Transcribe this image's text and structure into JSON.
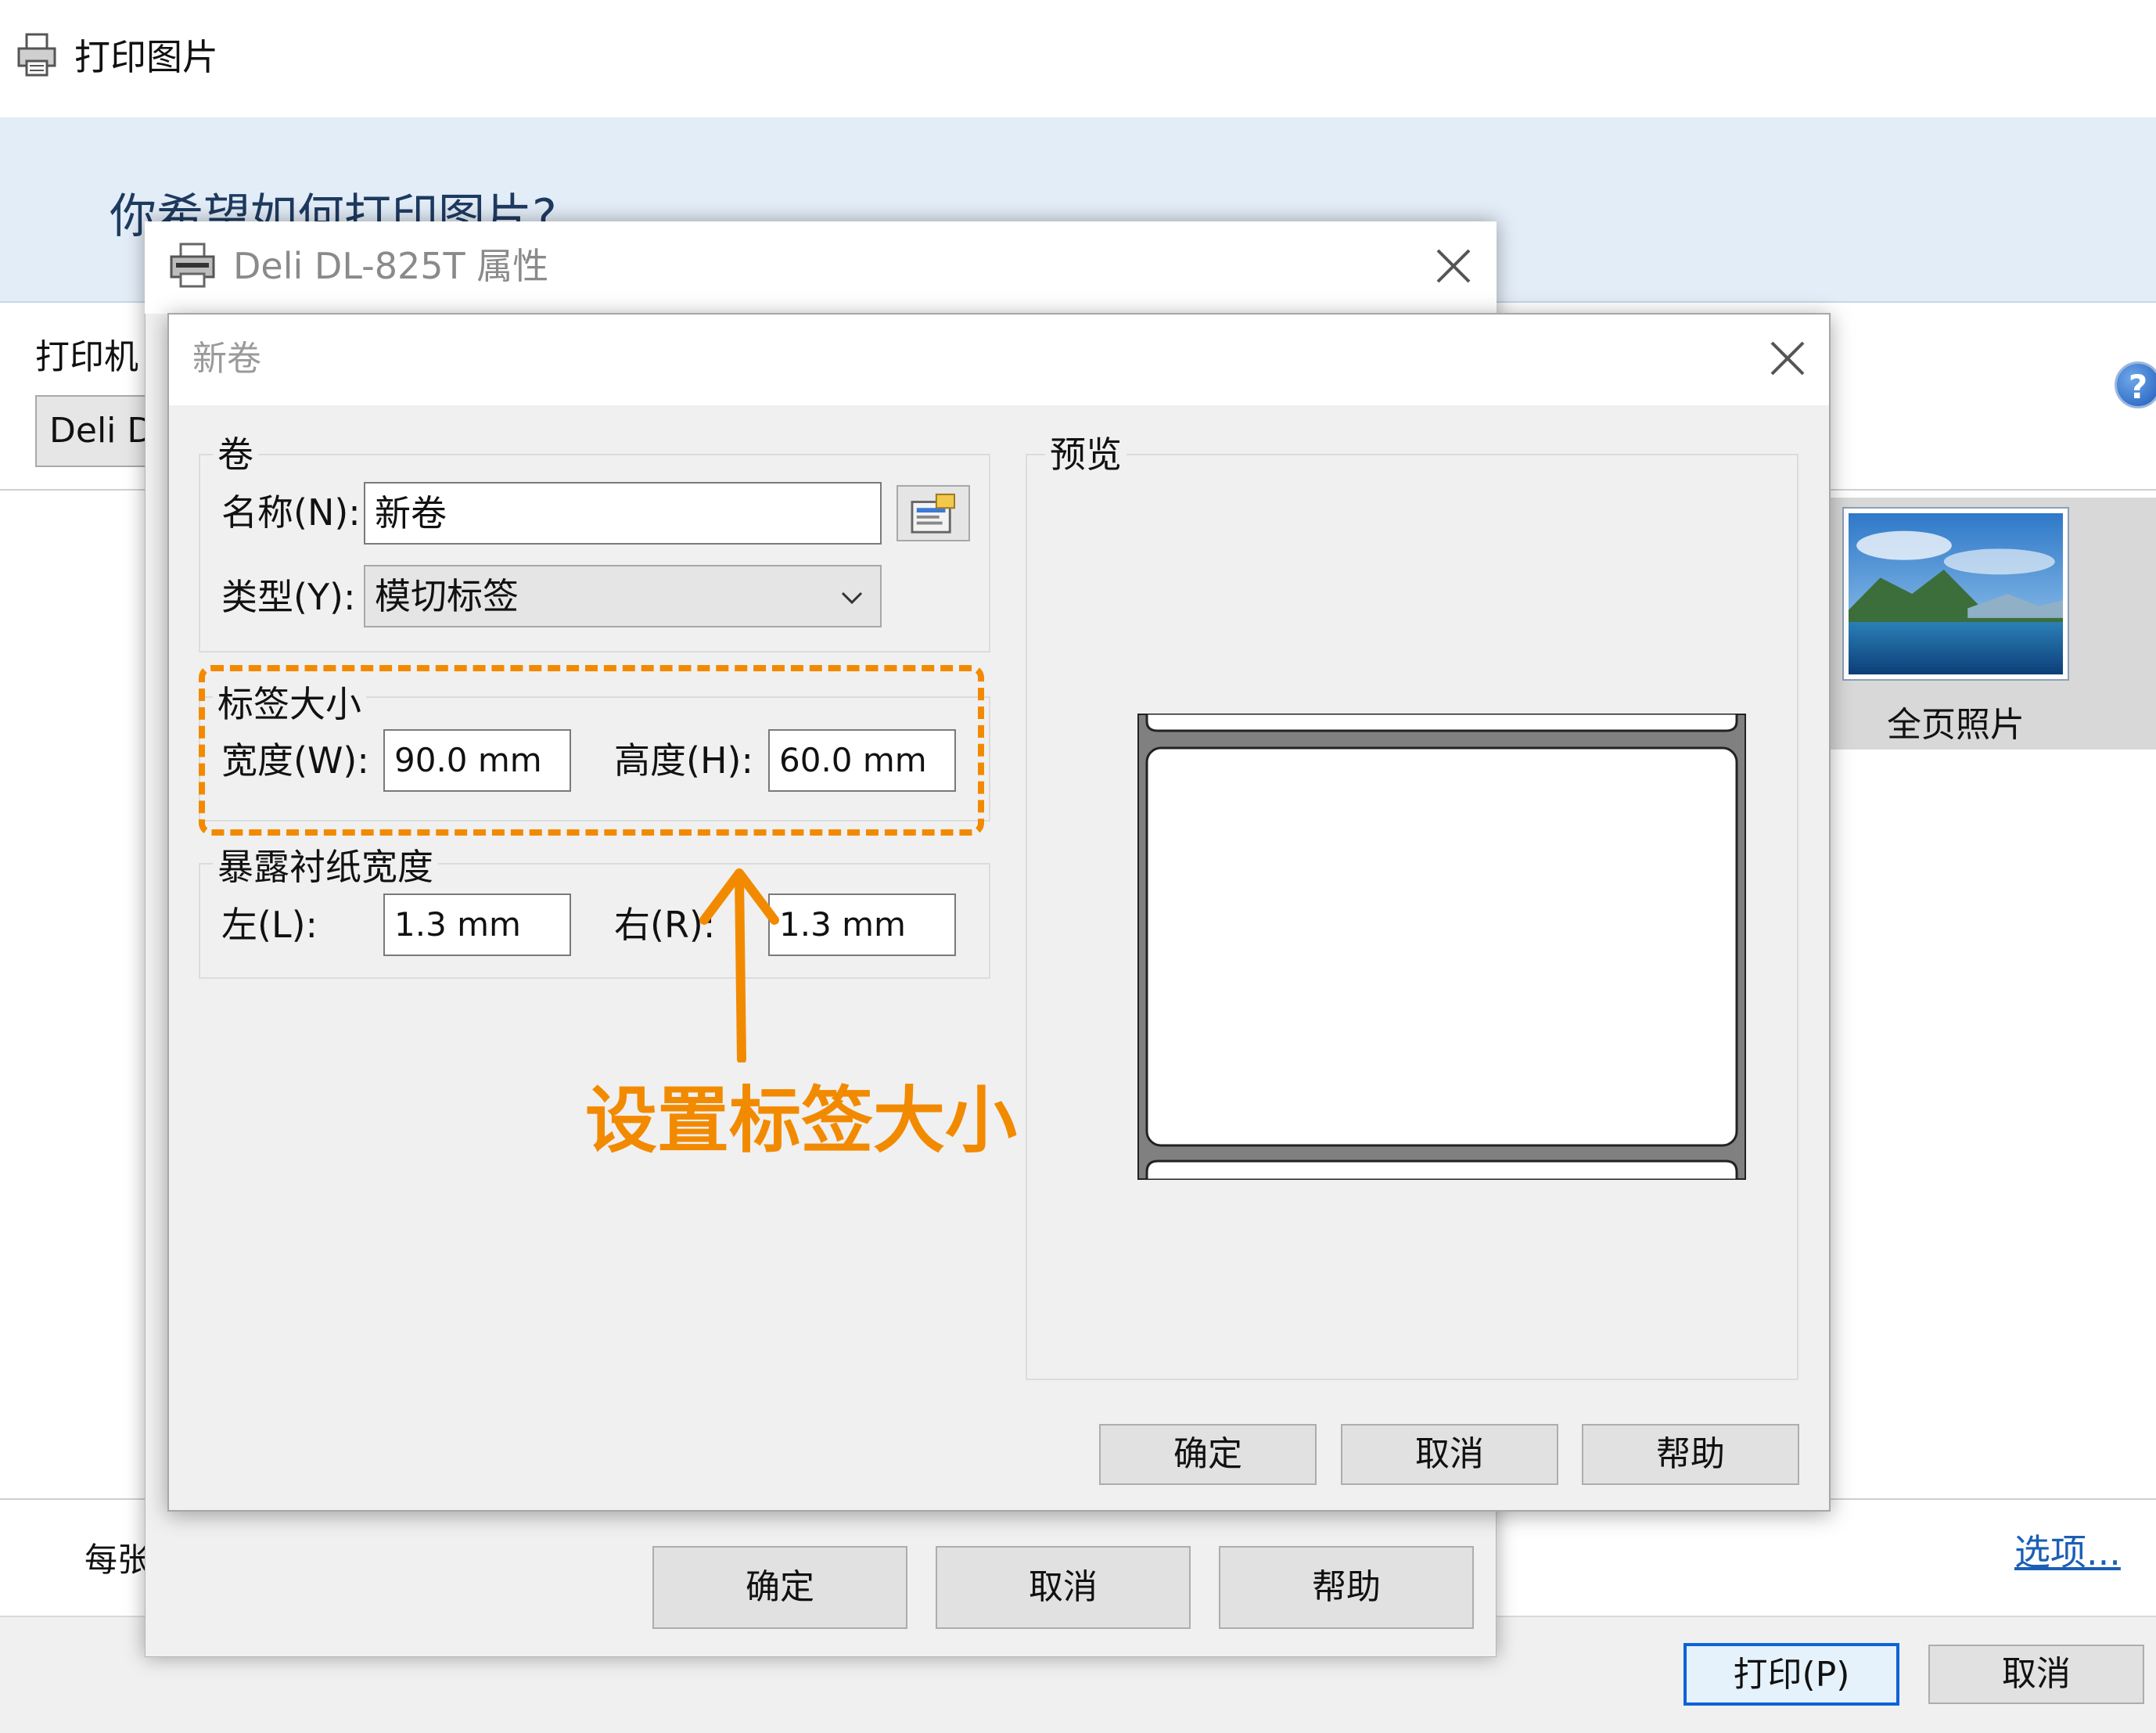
{
  "background_window": {
    "title": "打印图片",
    "question": "你希望如何打印图片?",
    "printer_label": "打印机",
    "printer_value": "Deli D",
    "layout_option": "全页照片",
    "copies_label": "每张",
    "options_link": "选项...",
    "print_button": "打印(P)",
    "cancel_button": "取消",
    "help_icon": "?"
  },
  "properties_dialog": {
    "title": "Deli DL-825T 属性",
    "ok_button": "确定",
    "cancel_button": "取消",
    "help_button": "帮助"
  },
  "new_roll_dialog": {
    "title": "新卷",
    "roll_group": {
      "title": "卷",
      "name_label": "名称(N):",
      "name_value": "新卷",
      "type_label": "类型(Y):",
      "type_value": "模切标签"
    },
    "label_size_group": {
      "title": "标签大小",
      "width_label": "宽度(W):",
      "width_value": "90.0 mm",
      "height_label": "高度(H):",
      "height_value": "60.0 mm"
    },
    "exposed_liner_group": {
      "title": "暴露衬纸宽度",
      "left_label": "左(L):",
      "left_value": "1.3 mm",
      "right_label": "右(R):",
      "right_value": "1.3 mm"
    },
    "preview_group": {
      "title": "预览"
    },
    "ok_button": "确定",
    "cancel_button": "取消",
    "help_button": "帮助"
  },
  "annotation": {
    "text": "设置标签大小",
    "color": "#f28a00"
  },
  "colors": {
    "accent_blue": "#0a64d6",
    "banner": "#e3edf8",
    "dialog_bg": "#f0f0f0",
    "preview_liner": "#808080"
  }
}
